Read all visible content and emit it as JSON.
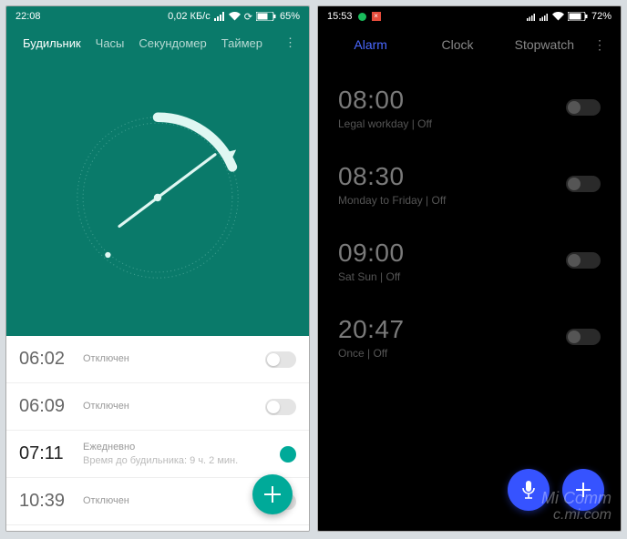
{
  "left": {
    "status": {
      "time": "22:08",
      "net_speed": "0,02 КБ/с",
      "battery": "65%"
    },
    "tabs": {
      "alarm": "Будильник",
      "clock": "Часы",
      "stopwatch": "Секундомер",
      "timer": "Таймер"
    },
    "alarms": [
      {
        "time": "06:02",
        "label": "Отключен",
        "sub": "",
        "on": false
      },
      {
        "time": "06:09",
        "label": "Отключен",
        "sub": "",
        "on": false
      },
      {
        "time": "07:11",
        "label": "Ежедневно",
        "sub": "Время до будильника: 9 ч. 2 мин.",
        "on": true
      },
      {
        "time": "10:39",
        "label": "Отключен",
        "sub": "",
        "on": false
      }
    ]
  },
  "right": {
    "status": {
      "time": "15:53",
      "battery": "72%"
    },
    "tabs": {
      "alarm": "Alarm",
      "clock": "Clock",
      "stopwatch": "Stopwatch"
    },
    "alarms": [
      {
        "time": "08:00",
        "label": "Legal workday  |  Off"
      },
      {
        "time": "08:30",
        "label": "Monday to Friday  |  Off"
      },
      {
        "time": "09:00",
        "label": "Sat Sun  |  Off"
      },
      {
        "time": "20:47",
        "label": "Once  |  Off"
      }
    ]
  },
  "watermark": {
    "l1": "Mi Comm",
    "l2": "c.mi.com"
  }
}
